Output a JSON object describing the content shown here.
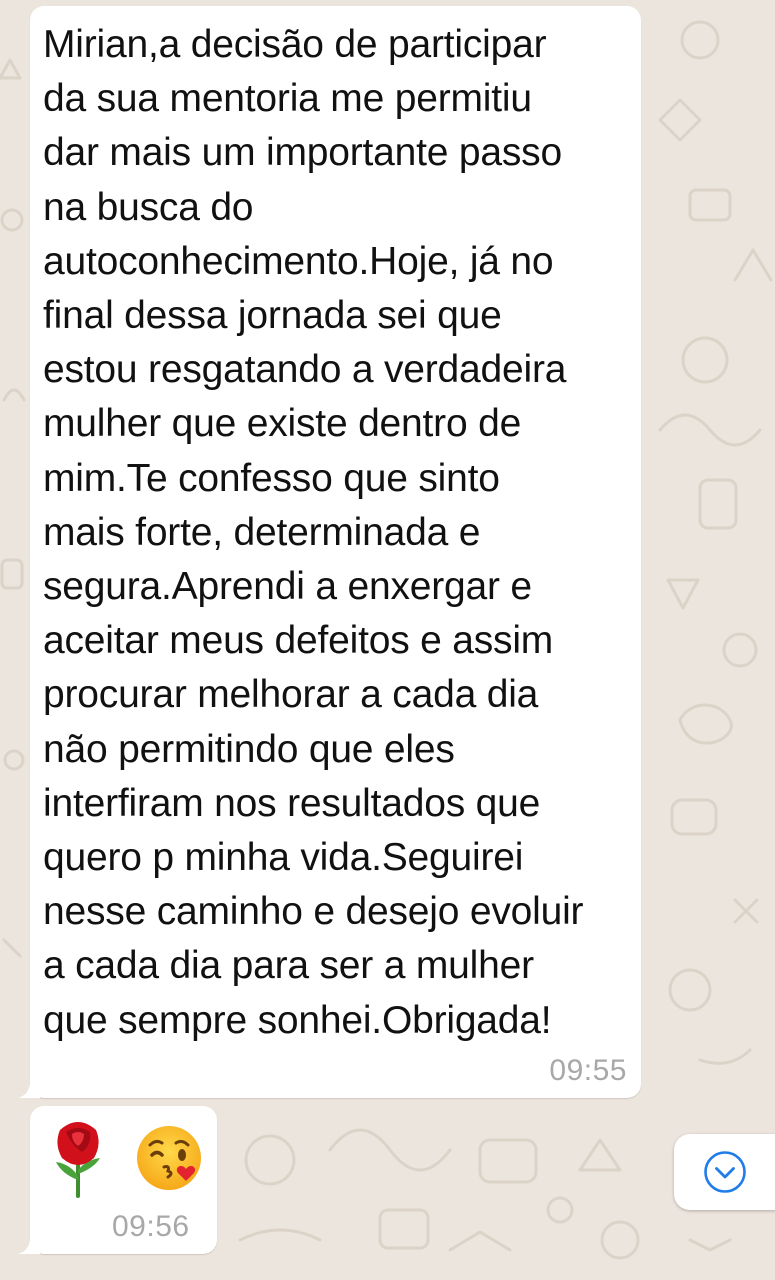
{
  "chat": {
    "messages": [
      {
        "type": "text",
        "lines": [
          "Mirian,a decisão de participar",
          "da sua mentoria me permitiu",
          "dar mais um importante passo",
          "na busca do",
          "autoconhecimento.Hoje, já no",
          "final dessa jornada sei que",
          "estou resgatando a verdadeira",
          "mulher que existe dentro de",
          "mim.Te confesso que sinto",
          "mais forte, determinada e",
          "segura.Aprendi a enxergar e",
          "aceitar meus defeitos e assim",
          "procurar melhorar a cada dia",
          "não permitindo que eles",
          "interfiram nos resultados que",
          "quero p minha vida.Seguirei",
          "nesse caminho e desejo evoluir",
          "a cada dia para ser a mulher",
          "que sempre sonhei.Obrigada!"
        ],
        "time": "09:55"
      },
      {
        "type": "emoji",
        "emojis": [
          "rose-emoji",
          "face-blowing-kiss-emoji"
        ],
        "time": "09:56"
      }
    ]
  },
  "scroll_button": {
    "icon": "chevron-down-circle-icon",
    "accent": "#1f7ce8"
  },
  "colors": {
    "wallpaper": "#ece5dd",
    "bubble": "#ffffff",
    "text": "#111111",
    "timestamp": "#a8a8a8"
  }
}
